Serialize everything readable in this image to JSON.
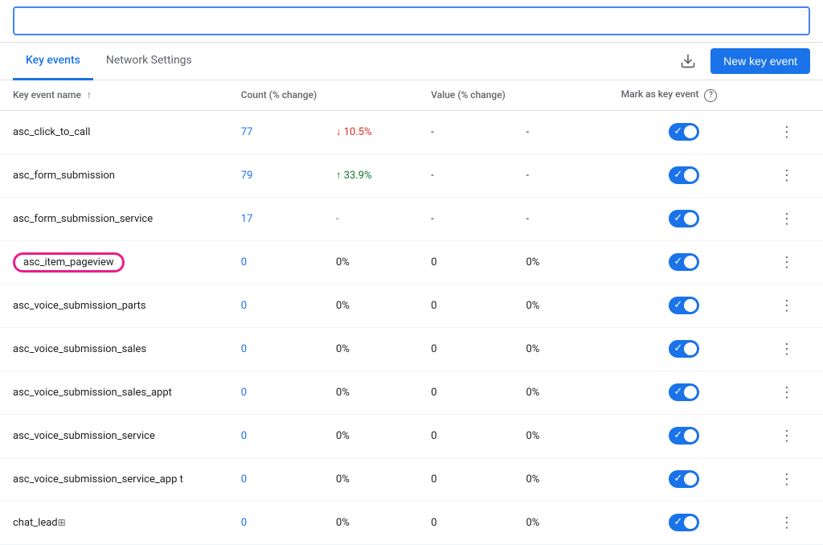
{
  "topbar": {
    "search_placeholder": ""
  },
  "tabs": {
    "items": [
      {
        "label": "Key events",
        "active": true
      },
      {
        "label": "Network Settings",
        "active": false
      }
    ],
    "download_title": "Download",
    "new_key_event_label": "New key event"
  },
  "table": {
    "columns": {
      "name": "Key event name",
      "count": "Count (% change)",
      "value": "Value (% change)",
      "mark": "Mark as key event"
    },
    "rows": [
      {
        "name": "asc_click_to_call",
        "count": "77",
        "count_change": "10.5%",
        "count_change_dir": "down",
        "value": "-",
        "value_change": "-",
        "marked": true,
        "highlight": false,
        "has_copy_icon": false
      },
      {
        "name": "asc_form_submission",
        "count": "79",
        "count_change": "33.9%",
        "count_change_dir": "up",
        "value": "-",
        "value_change": "-",
        "marked": true,
        "highlight": false,
        "has_copy_icon": false
      },
      {
        "name": "asc_form_submission_service",
        "count": "17",
        "count_change": "-",
        "count_change_dir": "none",
        "value": "-",
        "value_change": "-",
        "marked": true,
        "highlight": false,
        "has_copy_icon": false
      },
      {
        "name": "asc_item_pageview",
        "count": "0",
        "count_change": "0%",
        "count_change_dir": "none",
        "value": "0",
        "value_change": "0%",
        "marked": true,
        "highlight": true,
        "has_copy_icon": false
      },
      {
        "name": "asc_voice_submission_parts",
        "count": "0",
        "count_change": "0%",
        "count_change_dir": "none",
        "value": "0",
        "value_change": "0%",
        "marked": true,
        "highlight": false,
        "has_copy_icon": false
      },
      {
        "name": "asc_voice_submission_sales",
        "count": "0",
        "count_change": "0%",
        "count_change_dir": "none",
        "value": "0",
        "value_change": "0%",
        "marked": true,
        "highlight": false,
        "has_copy_icon": false
      },
      {
        "name": "asc_voice_submission_sales_appt",
        "count": "0",
        "count_change": "0%",
        "count_change_dir": "none",
        "value": "0",
        "value_change": "0%",
        "marked": true,
        "highlight": false,
        "has_copy_icon": false
      },
      {
        "name": "asc_voice_submission_service",
        "count": "0",
        "count_change": "0%",
        "count_change_dir": "none",
        "value": "0",
        "value_change": "0%",
        "marked": true,
        "highlight": false,
        "has_copy_icon": false
      },
      {
        "name": "asc_voice_submission_service_app\nt",
        "count": "0",
        "count_change": "0%",
        "count_change_dir": "none",
        "value": "0",
        "value_change": "0%",
        "marked": true,
        "highlight": false,
        "has_copy_icon": false
      },
      {
        "name": "chat_lead",
        "count": "0",
        "count_change": "0%",
        "count_change_dir": "none",
        "value": "0",
        "value_change": "0%",
        "marked": true,
        "highlight": false,
        "has_copy_icon": true
      }
    ]
  }
}
